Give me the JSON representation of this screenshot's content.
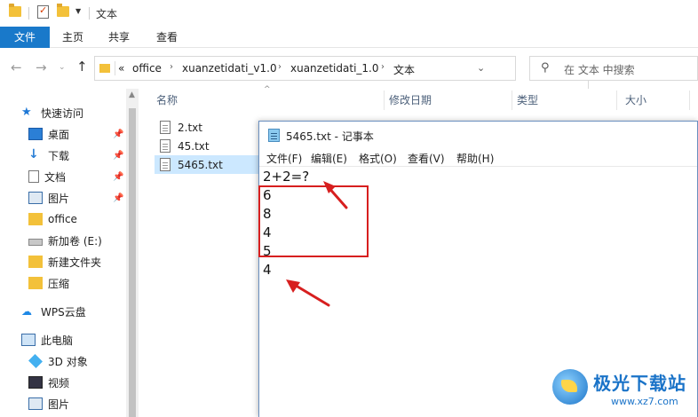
{
  "titlebar": {
    "title": "文本"
  },
  "ribbon": {
    "tabs": [
      "文件",
      "主页",
      "共享",
      "查看"
    ]
  },
  "address": {
    "prefix": "«",
    "crumbs": [
      "office",
      "xuanzetidati_v1.0",
      "xuanzetidati_1.0",
      "文本"
    ]
  },
  "search": {
    "placeholder": "在 文本 中搜索"
  },
  "sidebar": {
    "items": [
      {
        "label": "快速访问",
        "icon": "star-icon",
        "pinned": false
      },
      {
        "label": "桌面",
        "icon": "desktop-icon",
        "pinned": true
      },
      {
        "label": "下载",
        "icon": "download-icon",
        "pinned": true
      },
      {
        "label": "文档",
        "icon": "document-icon",
        "pinned": true
      },
      {
        "label": "图片",
        "icon": "pictures-icon",
        "pinned": true
      },
      {
        "label": "office",
        "icon": "folder-icon",
        "pinned": false
      },
      {
        "label": "新加卷 (E:)",
        "icon": "drive-icon",
        "pinned": false
      },
      {
        "label": "新建文件夹",
        "icon": "folder-icon",
        "pinned": false
      },
      {
        "label": "压缩",
        "icon": "folder-icon",
        "pinned": false
      },
      {
        "label": "WPS云盘",
        "icon": "cloud-icon",
        "pinned": false
      },
      {
        "label": "此电脑",
        "icon": "computer-icon",
        "pinned": false
      },
      {
        "label": "3D 对象",
        "icon": "3d-objects-icon",
        "pinned": false
      },
      {
        "label": "视频",
        "icon": "video-icon",
        "pinned": false
      },
      {
        "label": "图片",
        "icon": "pictures-icon",
        "pinned": false
      }
    ]
  },
  "columns": {
    "name": "名称",
    "modified": "修改日期",
    "type": "类型",
    "size": "大小"
  },
  "files": [
    {
      "name": "2.txt",
      "selected": false
    },
    {
      "name": "45.txt",
      "selected": false
    },
    {
      "name": "5465.txt",
      "selected": true
    }
  ],
  "notepad": {
    "title": "5465.txt - 记事本",
    "menu": [
      "文件(F)",
      "编辑(E)",
      "格式(O)",
      "查看(V)",
      "帮助(H)"
    ],
    "lines": [
      "2+2=?",
      "6",
      "8",
      "4",
      "5",
      "4"
    ]
  },
  "watermark": {
    "text": "极光下载站",
    "url": "www.xz7.com"
  },
  "colors": {
    "accent": "#1979ca",
    "selection": "#cce8ff",
    "highlight_box": "#d71f1f"
  }
}
